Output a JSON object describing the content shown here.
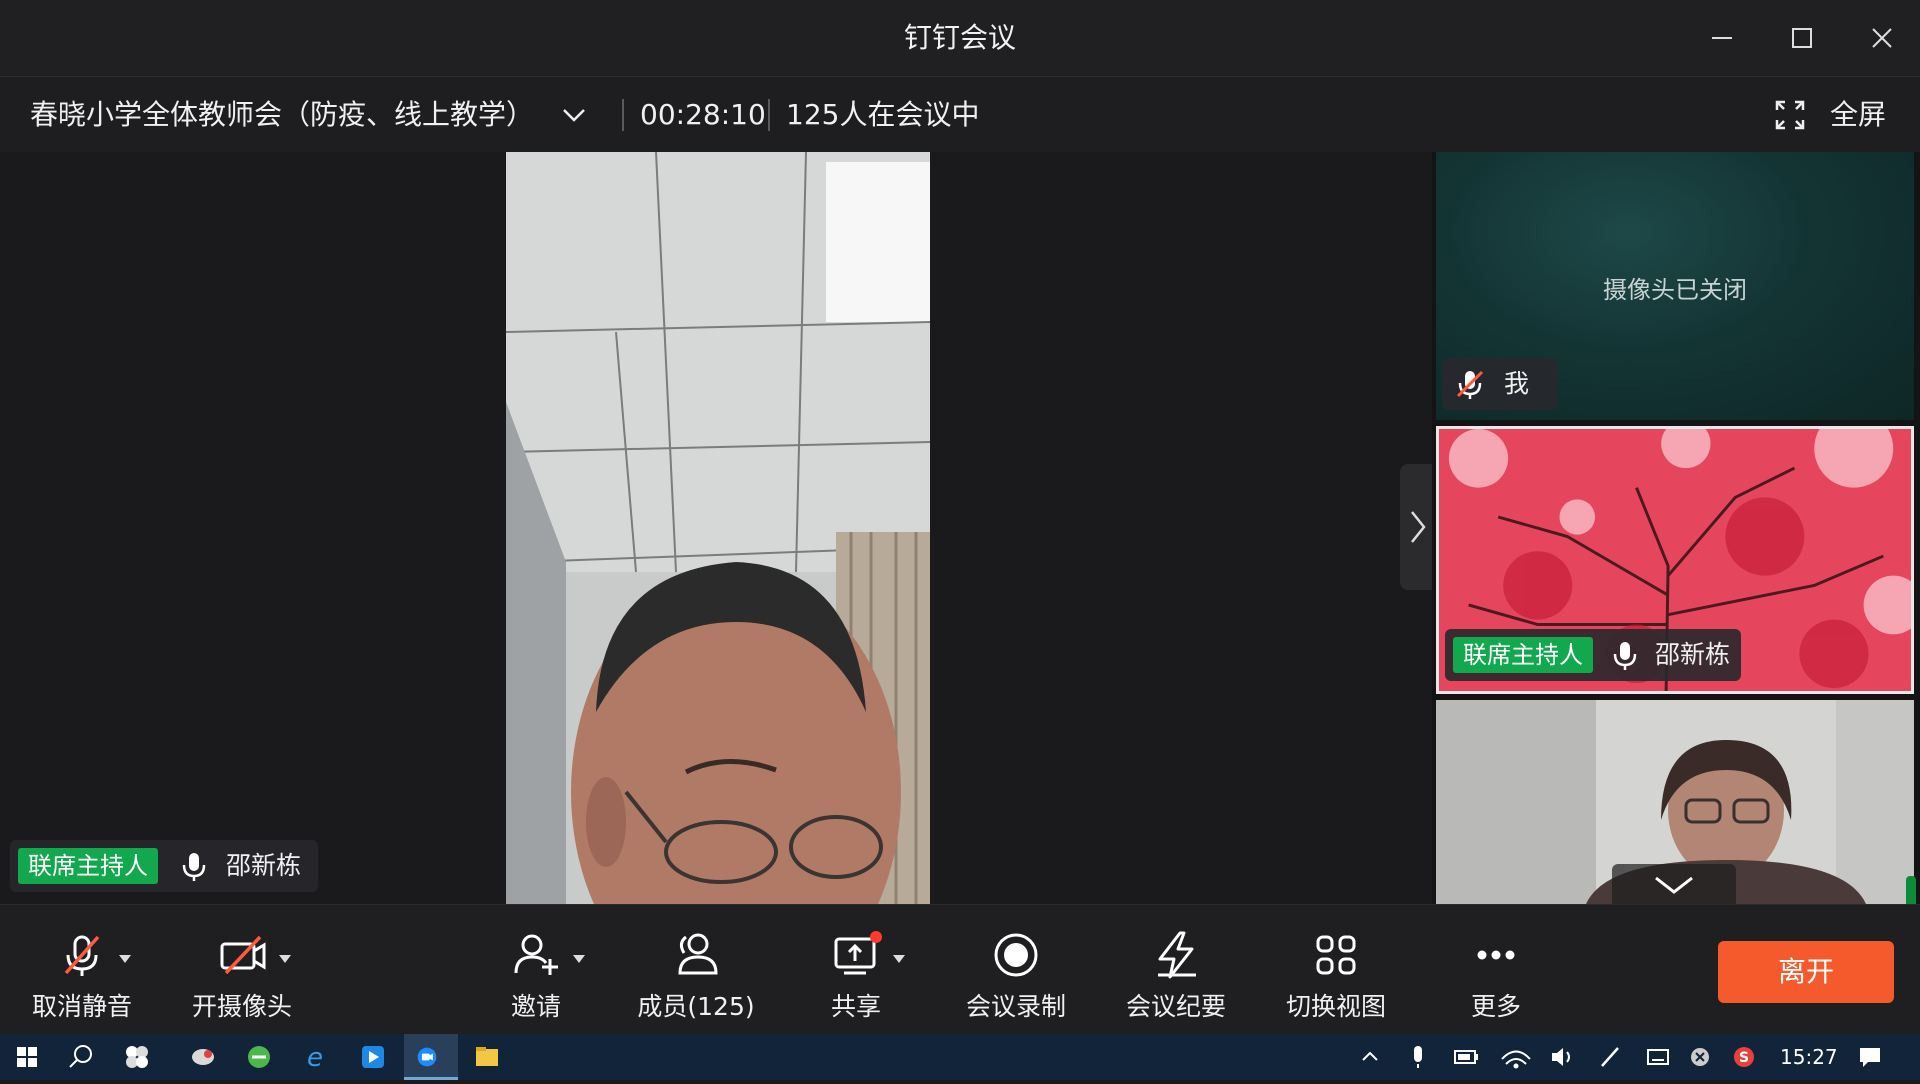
{
  "window": {
    "title": "钉钉会议"
  },
  "meeting": {
    "title": "春晓小学全体教师会（防疫、线上教学）",
    "timer": "00:28:10",
    "participants_text": "125人在会议中",
    "fullscreen_label": "全屏"
  },
  "main_video": {
    "host_badge": "联席主持人",
    "speaker_name": "邵新栋"
  },
  "tiles": [
    {
      "status_text": "摄像头已关闭",
      "name": "我",
      "muted": true
    },
    {
      "host_badge": "联席主持人",
      "name": "邵新栋",
      "muted": false
    },
    {
      "name": ""
    }
  ],
  "toolbar": {
    "mute_label": "取消静音",
    "camera_label": "开摄像头",
    "invite_label": "邀请",
    "members_label": "成员(125)",
    "share_label": "共享",
    "record_label": "会议录制",
    "minutes_label": "会议纪要",
    "switch_view_label": "切换视图",
    "more_label": "更多",
    "leave_label": "离开"
  },
  "taskbar": {
    "time": "15:27",
    "apps": [
      "start-icon",
      "search-icon",
      "app-pinwheel-icon",
      "app-bird-icon",
      "browser-green-icon",
      "ie-icon",
      "app-blue-icon",
      "dingtalk-meeting-icon",
      "file-explorer-icon"
    ],
    "tray": [
      "tray-arrow-icon",
      "microphone-icon",
      "battery-icon",
      "wifi-icon",
      "volume-icon",
      "pen-icon",
      "keyboard-icon",
      "close-circle-icon",
      "sogou-icon",
      "notification-icon"
    ]
  },
  "colors": {
    "host_badge": "#12a84e",
    "leave_button": "#f55a2c",
    "share_dot": "#ff3b30",
    "taskbar": "#11243a"
  }
}
